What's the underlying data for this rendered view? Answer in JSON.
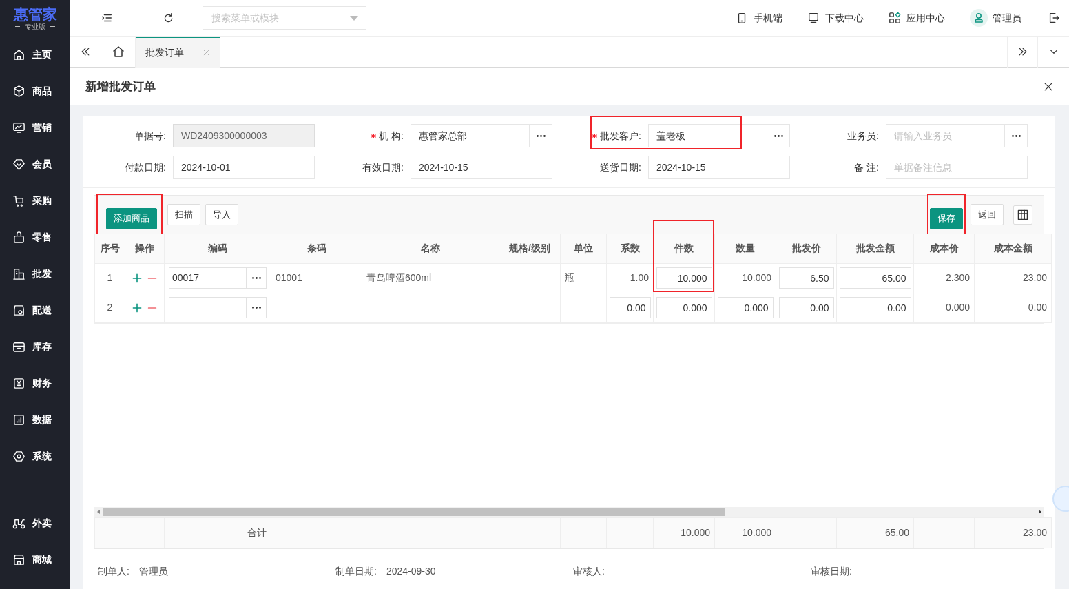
{
  "brand": {
    "name": "惠管家",
    "edition": "专业版"
  },
  "sidebar": {
    "items": [
      {
        "label": "主页",
        "selected": false
      },
      {
        "label": "商品",
        "selected": false
      },
      {
        "label": "营销",
        "selected": false
      },
      {
        "label": "会员",
        "selected": false
      },
      {
        "label": "采购",
        "selected": false
      },
      {
        "label": "零售",
        "selected": false
      },
      {
        "label": "批发",
        "selected": false
      },
      {
        "label": "配送",
        "selected": false
      },
      {
        "label": "库存",
        "selected": false
      },
      {
        "label": "财务",
        "selected": false
      },
      {
        "label": "数据",
        "selected": false
      },
      {
        "label": "系统",
        "selected": false
      }
    ],
    "extra_items": [
      {
        "label": "外卖",
        "selected": false
      },
      {
        "label": "商城",
        "selected": false
      }
    ]
  },
  "topbar": {
    "search": {
      "placeholder": "搜索菜单或模块"
    },
    "links": [
      "手机端",
      "下载中心",
      "应用中心"
    ],
    "user": "管理员"
  },
  "tabs": [
    {
      "label": "批发订单",
      "selected": true
    }
  ],
  "page": {
    "title": "新增批发订单"
  },
  "fields": [
    {
      "label": "单据号:",
      "value": "WD2409300000003",
      "readonly": true,
      "required": false,
      "picker": false,
      "highlighted": false
    },
    {
      "label": "机 构:",
      "value": "惠管家总部",
      "readonly": false,
      "required": true,
      "picker": true,
      "highlighted": false
    },
    {
      "label": "批发客户:",
      "value": "盖老板",
      "readonly": false,
      "required": true,
      "picker": true,
      "highlighted": true
    },
    {
      "label": "业务员:",
      "placeholder": "请输入业务员",
      "readonly": false,
      "required": false,
      "picker": true,
      "highlighted": false
    },
    {
      "label": "付款日期:",
      "value": "2024-10-01",
      "readonly": false,
      "required": false,
      "picker": false,
      "highlighted": false
    },
    {
      "label": "有效日期:",
      "value": "2024-10-15",
      "readonly": false,
      "required": false,
      "picker": false,
      "highlighted": false
    },
    {
      "label": "送货日期:",
      "value": "2024-10-15",
      "readonly": false,
      "required": false,
      "picker": false,
      "highlighted": false
    },
    {
      "label": "备 注:",
      "placeholder": "单据备注信息",
      "readonly": false,
      "required": false,
      "picker": false,
      "highlighted": false
    }
  ],
  "toolbar": {
    "left": [
      {
        "label": "添加商品",
        "primary": true,
        "highlighted": true
      },
      {
        "label": "扫描",
        "primary": false,
        "highlighted": false
      },
      {
        "label": "导入",
        "primary": false,
        "highlighted": false
      }
    ],
    "right": [
      {
        "label": "保存",
        "primary": true,
        "highlighted": true
      },
      {
        "label": "返回",
        "primary": false,
        "highlighted": false
      }
    ]
  },
  "table": {
    "columns": [
      {
        "label": "序号",
        "highlighted": false
      },
      {
        "label": "操作",
        "highlighted": false
      },
      {
        "label": "编码",
        "highlighted": false
      },
      {
        "label": "条码",
        "highlighted": false
      },
      {
        "label": "名称",
        "highlighted": false
      },
      {
        "label": "规格/级别",
        "highlighted": false
      },
      {
        "label": "单位",
        "highlighted": false
      },
      {
        "label": "系数",
        "highlighted": false
      },
      {
        "label": "件数",
        "highlighted": true
      },
      {
        "label": "数量",
        "highlighted": false
      },
      {
        "label": "批发价",
        "highlighted": false
      },
      {
        "label": "批发金额",
        "highlighted": false
      },
      {
        "label": "成本价",
        "highlighted": false
      },
      {
        "label": "成本金额",
        "highlighted": false
      }
    ],
    "rows": [
      {
        "cells": [
          {
            "kind": "center",
            "text": "1"
          },
          {
            "kind": "ops"
          },
          {
            "kind": "picker",
            "text": "00017"
          },
          {
            "kind": "text",
            "text": "01001"
          },
          {
            "kind": "text",
            "text": "青岛啤酒600ml"
          },
          {
            "kind": "blank"
          },
          {
            "kind": "text",
            "text": "瓶"
          },
          {
            "kind": "num",
            "text": "1.00"
          },
          {
            "kind": "input",
            "text": "10.000"
          },
          {
            "kind": "num",
            "text": "10.000"
          },
          {
            "kind": "input",
            "text": "6.50"
          },
          {
            "kind": "input",
            "text": "65.00"
          },
          {
            "kind": "num",
            "text": "2.300"
          },
          {
            "kind": "num",
            "text": "23.00"
          }
        ]
      },
      {
        "cells": [
          {
            "kind": "center",
            "text": "2"
          },
          {
            "kind": "ops"
          },
          {
            "kind": "picker"
          },
          {
            "kind": "blank"
          },
          {
            "kind": "blank"
          },
          {
            "kind": "blank"
          },
          {
            "kind": "blank"
          },
          {
            "kind": "input",
            "text": "0.00"
          },
          {
            "kind": "input",
            "text": "0.000"
          },
          {
            "kind": "input",
            "text": "0.000"
          },
          {
            "kind": "input",
            "text": "0.00"
          },
          {
            "kind": "input",
            "text": "0.00"
          },
          {
            "kind": "num",
            "text": "0.000"
          },
          {
            "kind": "num",
            "text": "0.00"
          }
        ]
      }
    ],
    "totals": [
      {
        "kind": "blank"
      },
      {
        "kind": "blank"
      },
      {
        "kind": "num",
        "text": "合计"
      },
      {
        "kind": "blank"
      },
      {
        "kind": "blank"
      },
      {
        "kind": "blank"
      },
      {
        "kind": "blank"
      },
      {
        "kind": "blank"
      },
      {
        "kind": "num",
        "text": "10.000"
      },
      {
        "kind": "num",
        "text": "10.000"
      },
      {
        "kind": "blank"
      },
      {
        "kind": "num",
        "text": "65.00"
      },
      {
        "kind": "blank"
      },
      {
        "kind": "num",
        "text": "23.00"
      }
    ]
  },
  "footer": [
    {
      "label": "制单人:",
      "value": "管理员"
    },
    {
      "label": "制单日期:",
      "value": "2024-09-30"
    },
    {
      "label": "审核人:"
    },
    {
      "label": "审核日期:"
    }
  ]
}
